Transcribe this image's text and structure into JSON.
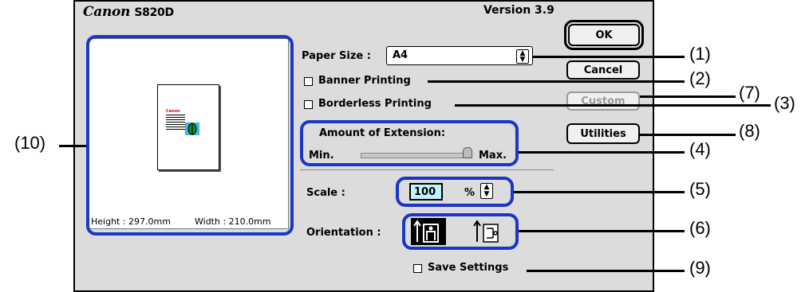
{
  "dialog": {
    "brand_logo": "Canon",
    "brand_model": "S820D",
    "version": "Version 3.9"
  },
  "buttons": {
    "ok": "OK",
    "cancel": "Cancel",
    "custom": "Custom",
    "utilities": "Utilities"
  },
  "paper_size": {
    "label": "Paper Size :",
    "value": "A4"
  },
  "banner_printing": {
    "label": "Banner Printing",
    "checked": false
  },
  "borderless_printing": {
    "label": "Borderless Printing",
    "checked": false
  },
  "extension": {
    "title": "Amount of Extension:",
    "min": "Min.",
    "max": "Max.",
    "level": 1.0
  },
  "scale": {
    "label": "Scale :",
    "value": "100",
    "unit": "%"
  },
  "orientation": {
    "label": "Orientation :"
  },
  "save_settings": {
    "label": "Save Settings",
    "checked": false
  },
  "preview": {
    "height_text": "Height : 297.0mm",
    "width_text": "Width : 210.0mm",
    "thumb_title": "Canon"
  },
  "callouts": [
    "(1)",
    "(2)",
    "(3)",
    "(4)",
    "(5)",
    "(6)",
    "(7)",
    "(8)",
    "(9)",
    "(10)"
  ],
  "colors": {
    "callout_blue": "#1a36c8",
    "dialog_bg": "#dcdcdc"
  }
}
